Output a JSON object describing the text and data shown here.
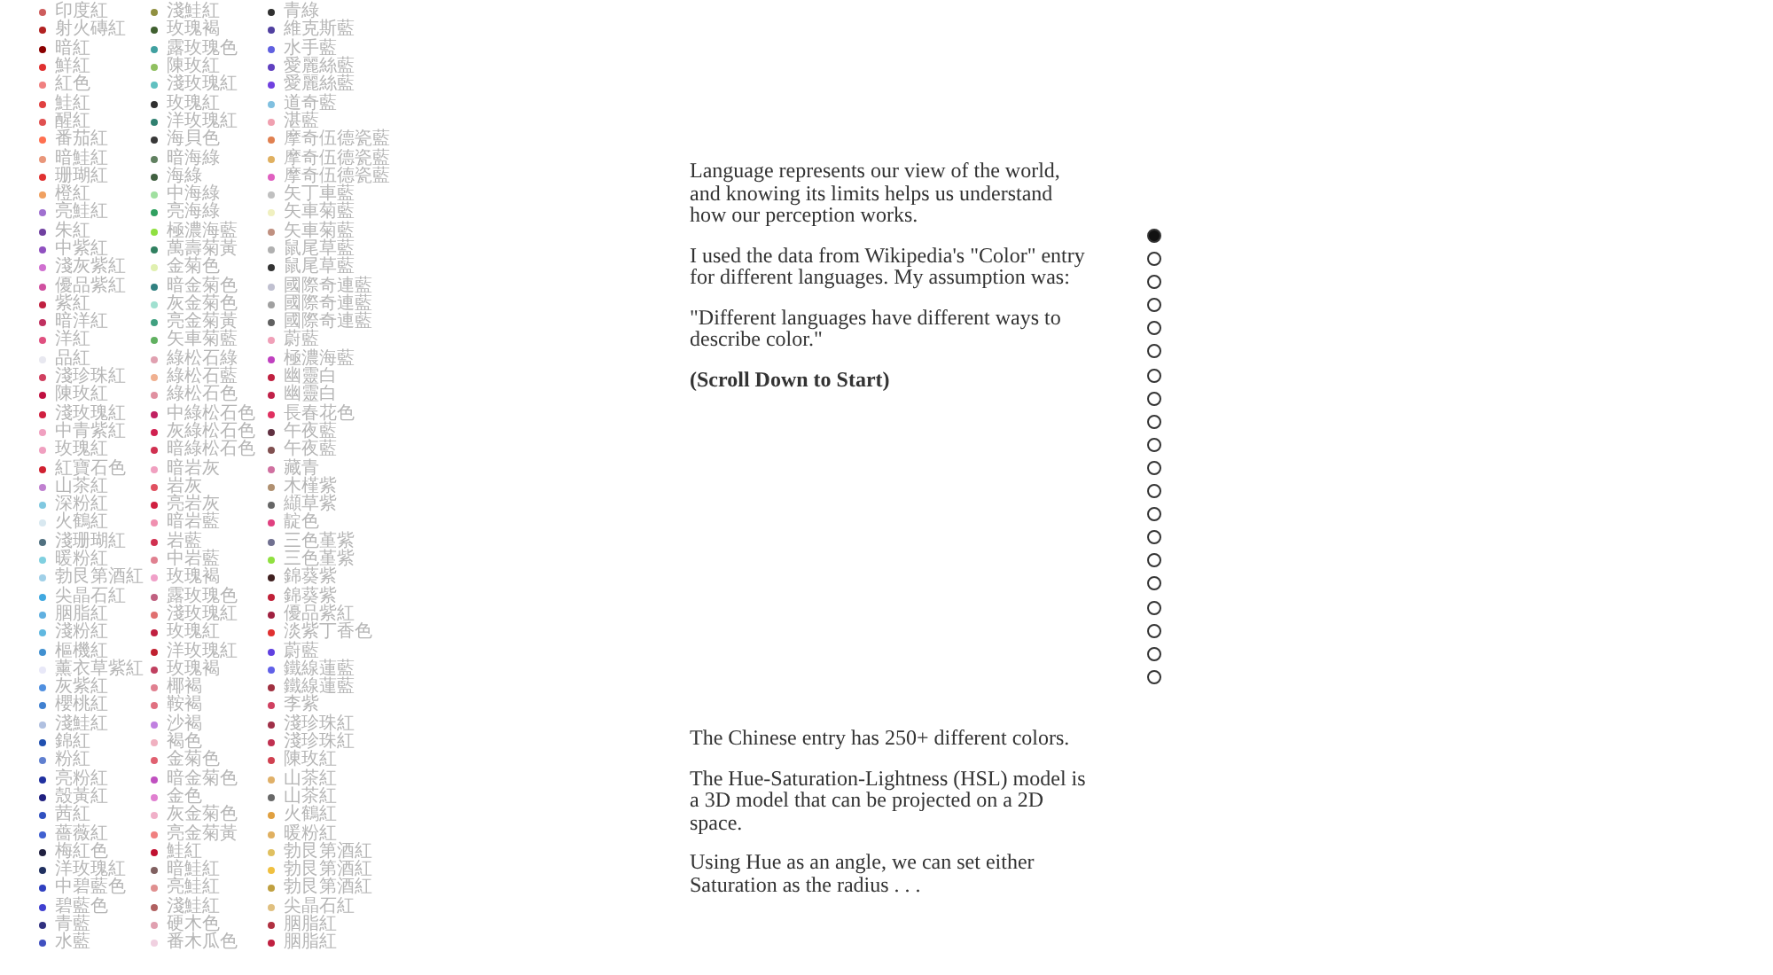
{
  "color_columns": [
    {
      "items": [
        {
          "name": "印度紅",
          "color": "#cd5c5c"
        },
        {
          "name": "射火磚紅",
          "color": "#b22222"
        },
        {
          "name": "暗紅",
          "color": "#8b0000"
        },
        {
          "name": "鮮紅",
          "color": "#e03030"
        },
        {
          "name": "紅色",
          "color": "#f08080"
        },
        {
          "name": "鮭紅",
          "color": "#e04040"
        },
        {
          "name": "醒紅",
          "color": "#e05050"
        },
        {
          "name": "番茄紅",
          "color": "#ff7050"
        },
        {
          "name": "暗鮭紅",
          "color": "#e9967a"
        },
        {
          "name": "珊瑚紅",
          "color": "#e03030"
        },
        {
          "name": "橙紅",
          "color": "#f0a060"
        },
        {
          "name": "亮鮭紅",
          "color": "#a070d0"
        },
        {
          "name": "朱紅",
          "color": "#7040a0"
        },
        {
          "name": "中紫紅",
          "color": "#9050c0"
        },
        {
          "name": "淺灰紫紅",
          "color": "#d070d0"
        },
        {
          "name": "優品紫紅",
          "color": "#d050a0"
        },
        {
          "name": "紫紅",
          "color": "#c02040"
        },
        {
          "name": "暗洋紅",
          "color": "#c03060"
        },
        {
          "name": "洋紅",
          "color": "#e05080"
        },
        {
          "name": "品紅",
          "color": "#e8e8f0"
        },
        {
          "name": "淺珍珠紅",
          "color": "#d04060"
        },
        {
          "name": "陳玫紅",
          "color": "#c01040"
        },
        {
          "name": "淺玫瑰紅",
          "color": "#d02040"
        },
        {
          "name": "中青紫紅",
          "color": "#f0a0c0"
        },
        {
          "name": "玫瑰紅",
          "color": "#f0a0c0"
        },
        {
          "name": "紅寶石色",
          "color": "#d02030"
        },
        {
          "name": "山茶紅",
          "color": "#c080d0"
        },
        {
          "name": "深粉紅",
          "color": "#80c8e0"
        },
        {
          "name": "火鶴紅",
          "color": "#d8e8f0"
        },
        {
          "name": "淺珊瑚紅",
          "color": "#507080"
        },
        {
          "name": "暖粉紅",
          "color": "#80d0e0"
        },
        {
          "name": "勃艮第酒紅",
          "color": "#a0d0e8"
        },
        {
          "name": "尖晶石紅",
          "color": "#40a8e0"
        },
        {
          "name": "胭脂紅",
          "color": "#60b0e0"
        },
        {
          "name": "淺粉紅",
          "color": "#60b8e0"
        },
        {
          "name": "樞機紅",
          "color": "#4090d0"
        },
        {
          "name": "薰衣草紫紅",
          "color": "#e8e8f8"
        },
        {
          "name": "灰紫紅",
          "color": "#5090e0"
        },
        {
          "name": "櫻桃紅",
          "color": "#4080d0"
        },
        {
          "name": "淺鮭紅",
          "color": "#b0c0e0"
        },
        {
          "name": "錦紅",
          "color": "#2050b0"
        },
        {
          "name": "粉紅",
          "color": "#6080d0"
        },
        {
          "name": "亮粉紅",
          "color": "#2030a0"
        },
        {
          "name": "殼黃紅",
          "color": "#202080"
        },
        {
          "name": "茜紅",
          "color": "#3050c0"
        },
        {
          "name": "薔薇紅",
          "color": "#4060d0"
        },
        {
          "name": "梅紅色",
          "color": "#202040"
        },
        {
          "name": "洋玫瑰紅",
          "color": "#203060"
        },
        {
          "name": "中碧藍色",
          "color": "#3040c0"
        },
        {
          "name": "碧藍色",
          "color": "#4040d0"
        },
        {
          "name": "青藍",
          "color": "#303080"
        },
        {
          "name": "水藍",
          "color": "#4050c0"
        }
      ]
    },
    {
      "items": [
        {
          "name": "淺鮭紅",
          "color": "#909040"
        },
        {
          "name": "玫瑰褐",
          "color": "#406030"
        },
        {
          "name": "露玫瑰色",
          "color": "#40a0a0"
        },
        {
          "name": "陳玫紅",
          "color": "#90c060"
        },
        {
          "name": "淺玫瑰紅",
          "color": "#60c0c0"
        },
        {
          "name": "玫瑰紅",
          "color": "#303030"
        },
        {
          "name": "洋玫瑰紅",
          "color": "#308070"
        },
        {
          "name": "海貝色",
          "color": "#383838"
        },
        {
          "name": "暗海綠",
          "color": "#608060"
        },
        {
          "name": "海綠",
          "color": "#406040"
        },
        {
          "name": "中海綠",
          "color": "#a0e0a0"
        },
        {
          "name": "亮海綠",
          "color": "#30a060"
        },
        {
          "name": "極濃海藍",
          "color": "#90e040"
        },
        {
          "name": "萬壽菊黃",
          "color": "#308060"
        },
        {
          "name": "金菊色",
          "color": "#e0f0b0"
        },
        {
          "name": "暗金菊色",
          "color": "#308080"
        },
        {
          "name": "灰金菊色",
          "color": "#a0e0d0"
        },
        {
          "name": "亮金菊黃",
          "color": "#40a080"
        },
        {
          "name": "矢車菊藍",
          "color": "#60b060"
        },
        {
          "name": "綠松石綠",
          "color": "#e0a0b0"
        },
        {
          "name": "綠松石藍",
          "color": "#f0b090"
        },
        {
          "name": "綠松石色",
          "color": "#e090a0"
        },
        {
          "name": "中綠松石色",
          "color": "#c02060"
        },
        {
          "name": "灰綠松石色",
          "color": "#d02050"
        },
        {
          "name": "暗綠松石色",
          "color": "#d03050"
        },
        {
          "name": "暗岩灰",
          "color": "#f0a0c0"
        },
        {
          "name": "岩灰",
          "color": "#e05060"
        },
        {
          "name": "亮岩灰",
          "color": "#d02040"
        },
        {
          "name": "暗岩藍",
          "color": "#f090b0"
        },
        {
          "name": "岩藍",
          "color": "#d03050"
        },
        {
          "name": "中岩藍",
          "color": "#e08090"
        },
        {
          "name": "玫瑰褐",
          "color": "#f0a0c8"
        },
        {
          "name": "露玫瑰色",
          "color": "#c06080"
        },
        {
          "name": "淺玫瑰紅",
          "color": "#e07070"
        },
        {
          "name": "玫瑰紅",
          "color": "#c02040"
        },
        {
          "name": "洋玫瑰紅",
          "color": "#c02030"
        },
        {
          "name": "玫瑰褐",
          "color": "#c04060"
        },
        {
          "name": "椰褐",
          "color": "#e08090"
        },
        {
          "name": "鞍褐",
          "color": "#e07080"
        },
        {
          "name": "沙褐",
          "color": "#c080e0"
        },
        {
          "name": "褐色",
          "color": "#f0b0c0"
        },
        {
          "name": "金菊色",
          "color": "#e06070"
        },
        {
          "name": "暗金菊色",
          "color": "#c050c0"
        },
        {
          "name": "金色",
          "color": "#e080d0"
        },
        {
          "name": "灰金菊色",
          "color": "#f0b0c8"
        },
        {
          "name": "亮金菊黃",
          "color": "#f08080"
        },
        {
          "name": "鮭紅",
          "color": "#c01030"
        },
        {
          "name": "暗鮭紅",
          "color": "#806060"
        },
        {
          "name": "亮鮭紅",
          "color": "#e09090"
        },
        {
          "name": "淺鮭紅",
          "color": "#b06060"
        },
        {
          "name": "硬木色",
          "color": "#e0a0b0"
        },
        {
          "name": "番木瓜色",
          "color": "#f0d0e0"
        }
      ]
    },
    {
      "items": [
        {
          "name": "青綠",
          "color": "#303030"
        },
        {
          "name": "維克斯藍",
          "color": "#5040a0"
        },
        {
          "name": "水手藍",
          "color": "#6060e0"
        },
        {
          "name": "愛麗絲藍",
          "color": "#6040c0"
        },
        {
          "name": "愛麗絲藍",
          "color": "#7040e0"
        },
        {
          "name": "道奇藍",
          "color": "#80c0e0"
        },
        {
          "name": "湛藍",
          "color": "#f0a0b0"
        },
        {
          "name": "摩奇伍德瓷藍",
          "color": "#e08050"
        },
        {
          "name": "摩奇伍德瓷藍",
          "color": "#e0b060"
        },
        {
          "name": "摩奇伍德瓷藍",
          "color": "#e060c0"
        },
        {
          "name": "矢丁車藍",
          "color": "#c0c0c0"
        },
        {
          "name": "矢車菊藍",
          "color": "#f0f0c0"
        },
        {
          "name": "矢車菊藍",
          "color": "#c09080"
        },
        {
          "name": "鼠尾草藍",
          "color": "#b0b0b0"
        },
        {
          "name": "鼠尾草藍",
          "color": "#333333"
        },
        {
          "name": "國際奇連藍",
          "color": "#c0c0d0"
        },
        {
          "name": "國際奇連藍",
          "color": "#a0a0a0"
        },
        {
          "name": "國際奇連藍",
          "color": "#606060"
        },
        {
          "name": "蔚藍",
          "color": "#f0a0b8"
        },
        {
          "name": "極濃海藍",
          "color": "#c040c0"
        },
        {
          "name": "幽靈白",
          "color": "#c02040"
        },
        {
          "name": "幽靈白",
          "color": "#c02048"
        },
        {
          "name": "長春花色",
          "color": "#e03060"
        },
        {
          "name": "午夜藍",
          "color": "#603040"
        },
        {
          "name": "午夜藍",
          "color": "#805050"
        },
        {
          "name": "藏青",
          "color": "#d070a0"
        },
        {
          "name": "木槿紫",
          "color": "#b09070"
        },
        {
          "name": "纈草紫",
          "color": "#666666"
        },
        {
          "name": "靛色",
          "color": "#e04080"
        },
        {
          "name": "三色堇紫",
          "color": "#707090"
        },
        {
          "name": "三色堇紫",
          "color": "#90e040"
        },
        {
          "name": "錦葵紫",
          "color": "#402020"
        },
        {
          "name": "錦葵紫",
          "color": "#c02038"
        },
        {
          "name": "優品紫紅",
          "color": "#a02040"
        },
        {
          "name": "淡紫丁香色",
          "color": "#e03030"
        },
        {
          "name": "蔚藍",
          "color": "#6040e0"
        },
        {
          "name": "鐵線蓮藍",
          "color": "#6060e8"
        },
        {
          "name": "鐵線蓮藍",
          "color": "#a03040"
        },
        {
          "name": "李紫",
          "color": "#d04060"
        },
        {
          "name": "淺珍珠紅",
          "color": "#a03048"
        },
        {
          "name": "淺珍珠紅",
          "color": "#c03050"
        },
        {
          "name": "陳玫紅",
          "color": "#d04050"
        },
        {
          "name": "山茶紅",
          "color": "#e0b068"
        },
        {
          "name": "山茶紅",
          "color": "#686868"
        },
        {
          "name": "火鶴紅",
          "color": "#e0a040"
        },
        {
          "name": "暖粉紅",
          "color": "#e0b060"
        },
        {
          "name": "勃艮第酒紅",
          "color": "#e0c060"
        },
        {
          "name": "勃艮第酒紅",
          "color": "#f0c040"
        },
        {
          "name": "勃艮第酒紅",
          "color": "#c0a040"
        },
        {
          "name": "尖晶石紅",
          "color": "#e0c080"
        },
        {
          "name": "胭脂紅",
          "color": "#b03040"
        },
        {
          "name": "胭脂紅",
          "color": "#c02040"
        }
      ]
    }
  ],
  "intro": {
    "paragraphs": [
      {
        "kind": "body",
        "text": "Language represents our view of the world, and knowing its limits helps us understand how our perception works."
      },
      {
        "kind": "body",
        "text": "I used the data from Wikipedia's \"Color\" entry for different languages. My assumption was:"
      },
      {
        "kind": "body",
        "text": "\"Different languages have different ways to describe color.\""
      },
      {
        "kind": "emphasis",
        "text": "(Scroll Down to Start)"
      }
    ]
  },
  "progress_dots": [
    {
      "selected": true
    },
    {
      "selected": false
    },
    {
      "selected": false
    },
    {
      "selected": false
    },
    {
      "selected": false
    },
    {
      "selected": false
    },
    {
      "selected": false
    },
    {
      "selected": false
    },
    {
      "selected": false
    },
    {
      "selected": false
    },
    {
      "selected": false
    },
    {
      "selected": false
    },
    {
      "selected": false
    },
    {
      "selected": false
    },
    {
      "selected": false
    },
    {
      "selected": false
    },
    {
      "selected": false
    },
    {
      "selected": false
    },
    {
      "selected": false
    },
    {
      "selected": false
    }
  ],
  "next_section": {
    "paragraphs": [
      "The Chinese entry has 250+ different colors.",
      "The Hue-Saturation-Lightness (HSL) model is a 3D model that can be projected on a 2D space.",
      "Using Hue as an angle, we can set either Saturation as the radius . . ."
    ]
  }
}
